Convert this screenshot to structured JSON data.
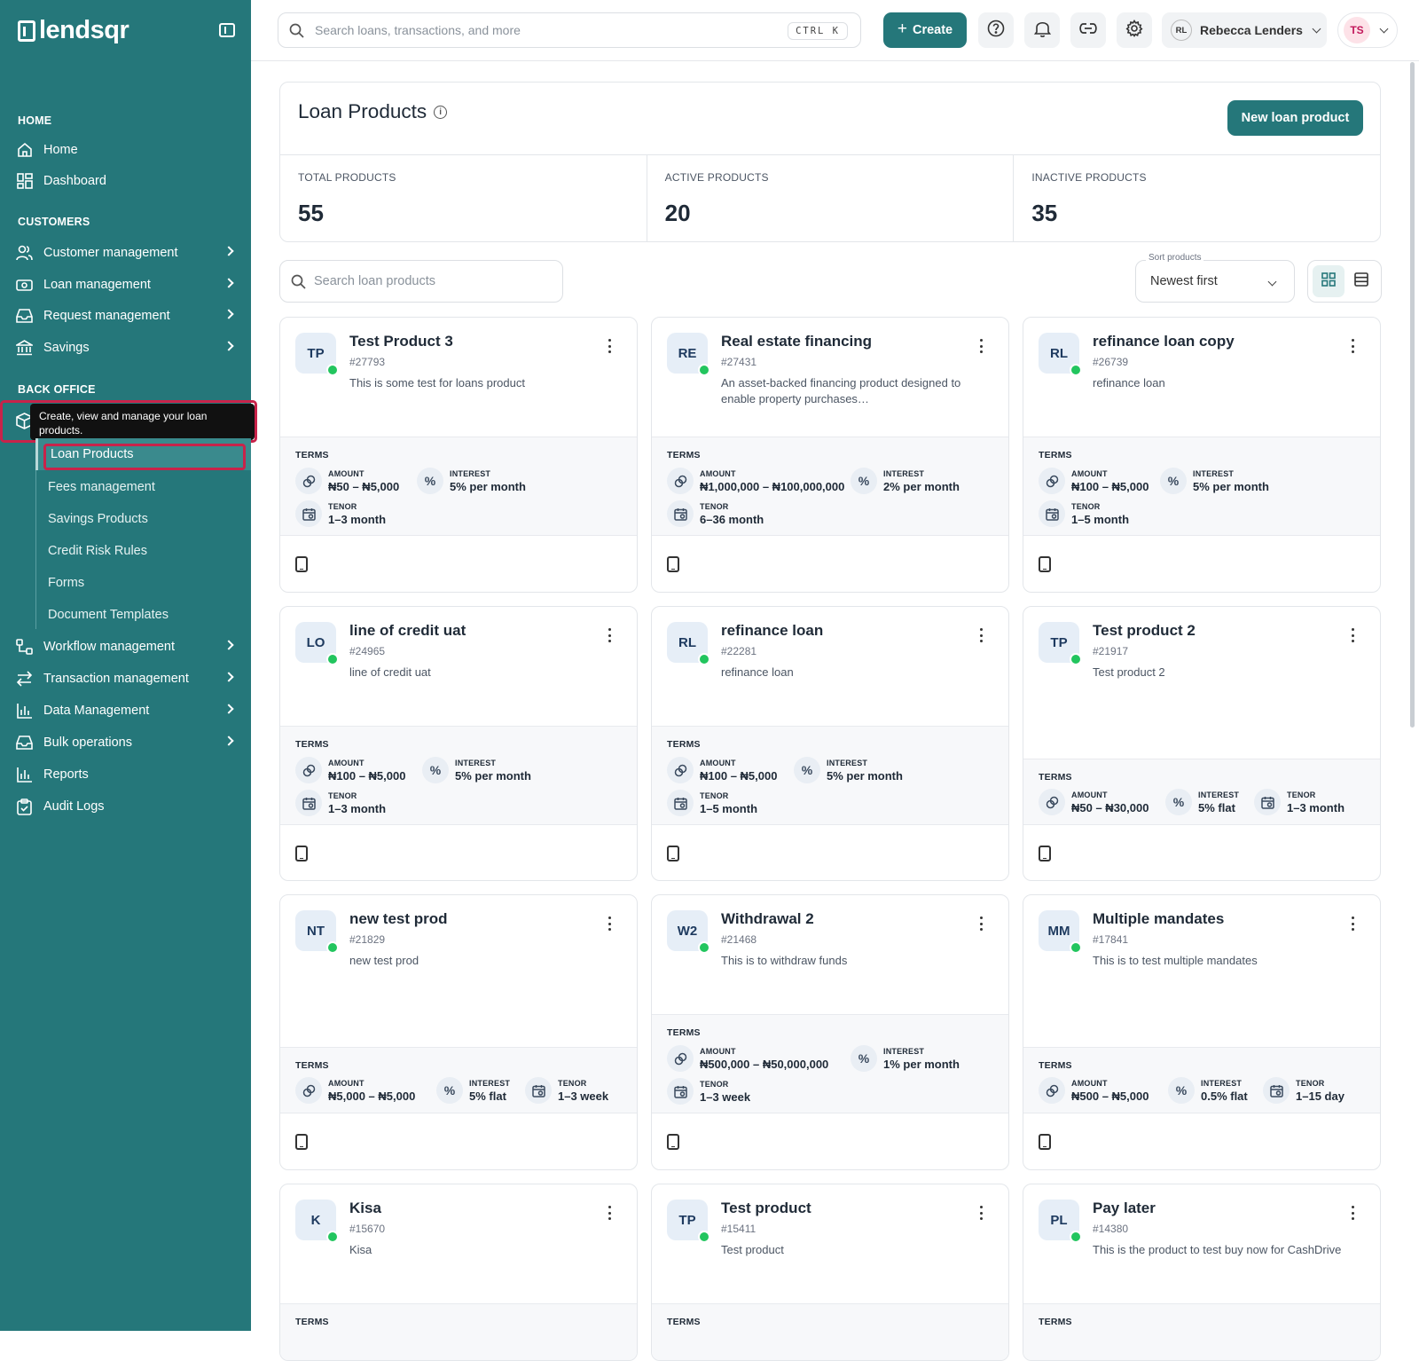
{
  "app": {
    "logo_text": "lendsqr"
  },
  "topbar": {
    "search_placeholder": "Search loans, transactions, and more",
    "shortcut": "CTRL K",
    "create_label": "Create",
    "user_initials": "RL",
    "user_name": "Rebecca Lenders",
    "avatar_initials": "TS"
  },
  "sidebar": {
    "section_home": "HOME",
    "home": "Home",
    "dashboard": "Dashboard",
    "section_customers": "CUSTOMERS",
    "customer_management": "Customer management",
    "loan_management": "Loan management",
    "request_management": "Request management",
    "savings": "Savings",
    "section_back_office": "BACK OFFICE",
    "tooltip": "Create, view and manage your loan products.",
    "sub_items": [
      "Loan Products",
      "Fees management",
      "Savings Products",
      "Credit Risk Rules",
      "Forms",
      "Document Templates"
    ],
    "workflow_management": "Workflow management",
    "transaction_management": "Transaction management",
    "data_management": "Data Management",
    "bulk_operations": "Bulk operations",
    "reports": "Reports",
    "audit_logs": "Audit Logs"
  },
  "page": {
    "title": "Loan Products",
    "new_button": "New loan product",
    "stats": [
      {
        "label": "TOTAL PRODUCTS",
        "value": "55"
      },
      {
        "label": "ACTIVE PRODUCTS",
        "value": "20"
      },
      {
        "label": "INACTIVE PRODUCTS",
        "value": "35"
      }
    ],
    "search_placeholder": "Search loan products",
    "sort_label": "Sort products",
    "sort_value": "Newest first",
    "terms_label": "TERMS",
    "amount_label": "AMOUNT",
    "interest_label": "INTEREST",
    "tenor_label": "TENOR"
  },
  "products": [
    {
      "initials": "TP",
      "name": "Test Product 3",
      "id": "#27793",
      "desc": "This is some test for loans product",
      "amount": "₦50 – ₦5,000",
      "interest": "5% per month",
      "tenor": "1–3 month",
      "status_color": "#22c55e"
    },
    {
      "initials": "RE",
      "name": "Real estate financing",
      "id": "#27431",
      "desc": "An asset-backed financing product designed to enable property purchases…",
      "amount": "₦1,000,000 – ₦100,000,000",
      "interest": "2% per month",
      "tenor": "6–36 month",
      "status_color": "#22c55e"
    },
    {
      "initials": "RL",
      "name": "refinance loan copy",
      "id": "#26739",
      "desc": "refinance loan",
      "amount": "₦100 – ₦5,000",
      "interest": "5% per month",
      "tenor": "1–5 month",
      "status_color": "#22c55e"
    },
    {
      "initials": "LO",
      "name": "line of credit uat",
      "id": "#24965",
      "desc": "line of credit uat",
      "amount": "₦100 – ₦5,000",
      "interest": "5% per month",
      "tenor": "1–3 month",
      "status_color": "#22c55e"
    },
    {
      "initials": "RL",
      "name": "refinance loan",
      "id": "#22281",
      "desc": "refinance loan",
      "amount": "₦100 – ₦5,000",
      "interest": "5% per month",
      "tenor": "1–5 month",
      "status_color": "#22c55e"
    },
    {
      "initials": "TP",
      "name": "Test product 2",
      "id": "#21917",
      "desc": "Test product 2",
      "amount": "₦50 – ₦30,000",
      "interest": "5% flat",
      "tenor": "1–3 month",
      "status_color": "#22c55e"
    },
    {
      "initials": "NT",
      "name": "new test prod",
      "id": "#21829",
      "desc": "new test prod",
      "amount": "₦5,000 – ₦5,000",
      "interest": "5% flat",
      "tenor": "1–3 week",
      "status_color": "#22c55e"
    },
    {
      "initials": "W2",
      "name": "Withdrawal 2",
      "id": "#21468",
      "desc": "This is to withdraw funds",
      "amount": "₦500,000 – ₦50,000,000",
      "interest": "1% per month",
      "tenor": "1–3 week",
      "status_color": "#22c55e"
    },
    {
      "initials": "MM",
      "name": "Multiple mandates",
      "id": "#17841",
      "desc": "This is to test multiple mandates",
      "amount": "₦500 – ₦5,000",
      "interest": "0.5% flat",
      "tenor": "1–15 day",
      "status_color": "#22c55e"
    },
    {
      "initials": "K",
      "name": "Kisa",
      "id": "#15670",
      "desc": "Kisa",
      "status_color": "#22c55e"
    },
    {
      "initials": "TP",
      "name": "Test product",
      "id": "#15411",
      "desc": "Test product",
      "status_color": "#22c55e"
    },
    {
      "initials": "PL",
      "name": "Pay later",
      "id": "#14380",
      "desc": "This is the product to test buy now for CashDrive",
      "status_color": "#22c55e"
    }
  ]
}
